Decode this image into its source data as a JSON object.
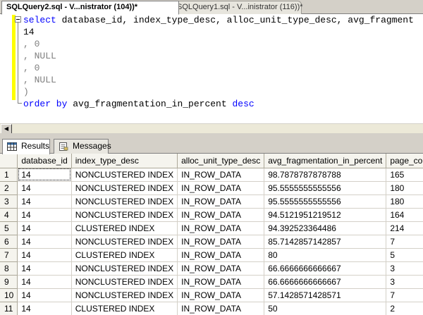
{
  "tabs": [
    {
      "label": "SQLQuery2.sql - V...nistrator (104))*",
      "active": true
    },
    {
      "label": "SQLQuery1.sql - V...inistrator (116))*",
      "active": false
    }
  ],
  "editor": {
    "line1": {
      "kw1": "select",
      "text": " database_id, index_type_desc, alloc_unit_type_desc, avg_fragment"
    },
    "line2": "14",
    "line3": ", 0",
    "line4": ", NULL",
    "line5": ", 0",
    "line6": ", NULL",
    "line7": ")",
    "line8": {
      "kw1": "order by",
      "text": " avg_fragmentation_in_percent ",
      "kw2": "desc"
    }
  },
  "results_tabs": [
    {
      "label": "Results",
      "icon": "grid-icon",
      "active": true
    },
    {
      "label": "Messages",
      "icon": "messages-icon",
      "active": false
    }
  ],
  "grid": {
    "columns": [
      "database_id",
      "index_type_desc",
      "alloc_unit_type_desc",
      "avg_fragmentation_in_percent",
      "page_count"
    ],
    "rows": [
      [
        "1",
        "14",
        "NONCLUSTERED INDEX",
        "IN_ROW_DATA",
        "98.7878787878788",
        "165"
      ],
      [
        "2",
        "14",
        "NONCLUSTERED INDEX",
        "IN_ROW_DATA",
        "95.5555555555556",
        "180"
      ],
      [
        "3",
        "14",
        "NONCLUSTERED INDEX",
        "IN_ROW_DATA",
        "95.5555555555556",
        "180"
      ],
      [
        "4",
        "14",
        "NONCLUSTERED INDEX",
        "IN_ROW_DATA",
        "94.5121951219512",
        "164"
      ],
      [
        "5",
        "14",
        "CLUSTERED INDEX",
        "IN_ROW_DATA",
        "94.392523364486",
        "214"
      ],
      [
        "6",
        "14",
        "NONCLUSTERED INDEX",
        "IN_ROW_DATA",
        "85.7142857142857",
        "7"
      ],
      [
        "7",
        "14",
        "CLUSTERED INDEX",
        "IN_ROW_DATA",
        "80",
        "5"
      ],
      [
        "8",
        "14",
        "NONCLUSTERED INDEX",
        "IN_ROW_DATA",
        "66.6666666666667",
        "3"
      ],
      [
        "9",
        "14",
        "NONCLUSTERED INDEX",
        "IN_ROW_DATA",
        "66.6666666666667",
        "3"
      ],
      [
        "10",
        "14",
        "NONCLUSTERED INDEX",
        "IN_ROW_DATA",
        "57.1428571428571",
        "7"
      ],
      [
        "11",
        "14",
        "CLUSTERED INDEX",
        "IN_ROW_DATA",
        "50",
        "2"
      ]
    ]
  },
  "colors": {
    "keyword": "#0000ff",
    "operator": "#808080",
    "change_bar": "#ffff00"
  }
}
